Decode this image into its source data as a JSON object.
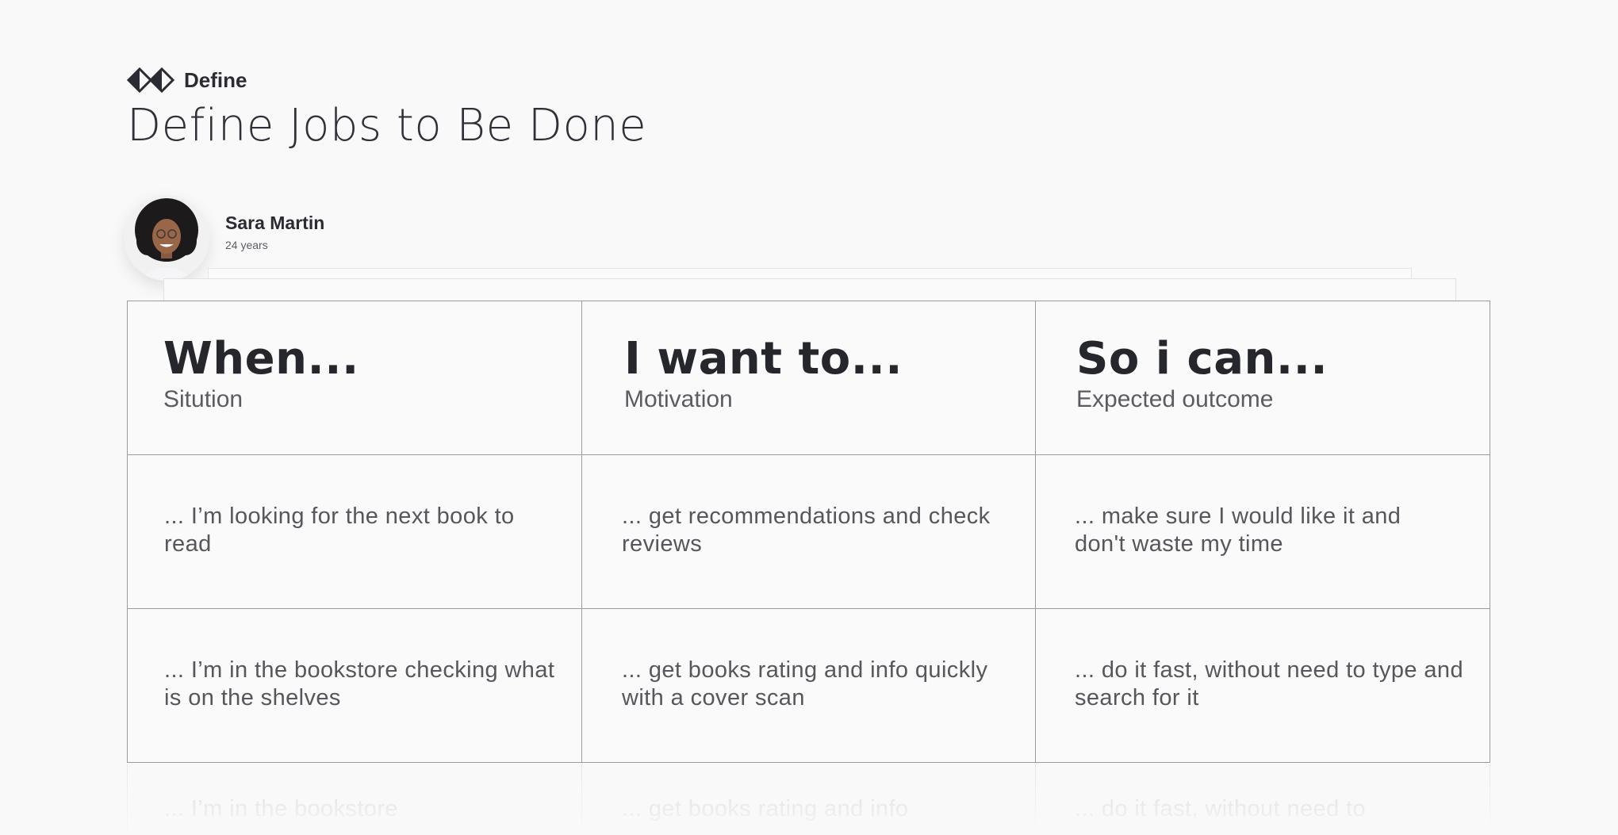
{
  "header": {
    "step_label": "Define",
    "title": "Define Jobs to Be Done",
    "step_icon": "define-diamond-icon"
  },
  "persona": {
    "name": "Sara Martin",
    "age": "24 years",
    "avatar_icon": "user-avatar"
  },
  "columns": [
    {
      "title": "When...",
      "subtitle": "Sitution"
    },
    {
      "title": "I want to...",
      "subtitle": "Motivation"
    },
    {
      "title": "So i can...",
      "subtitle": "Expected outcome"
    }
  ],
  "rows": [
    [
      "... I’m looking for the next book to read",
      "... get recommendations and check reviews",
      "... make sure I would like it and don't waste my time"
    ],
    [
      "... I’m in the bookstore checking what is on the shelves",
      "... get books rating and info quickly with a cover scan",
      "... do it fast, without need to type and search for it"
    ]
  ],
  "reflection": [
    "... I’m in the bookstore",
    "... get books rating and info",
    "... do it fast, without need to"
  ],
  "colors": {
    "background": "#f9f9f9",
    "text_dark": "#2a2b33",
    "text_muted": "#56565c",
    "grid_line": "#9c9ca0"
  }
}
